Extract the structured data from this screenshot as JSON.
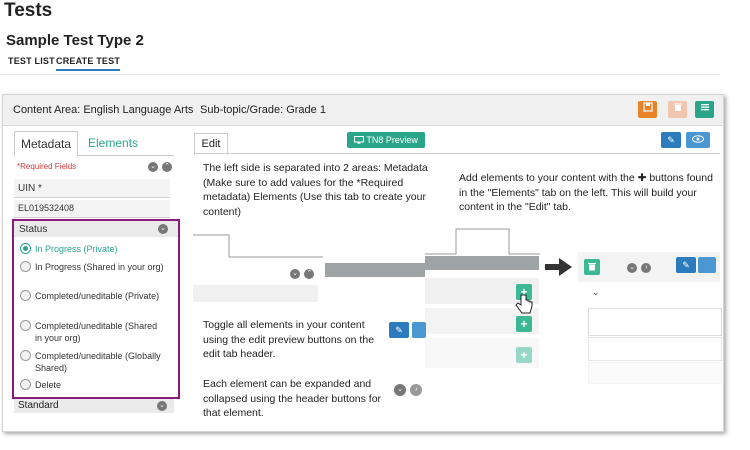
{
  "page": {
    "title": "Tests",
    "subtitle": "Sample Test Type 2",
    "tabs": [
      "TEST LIST",
      "CREATE TEST"
    ]
  },
  "header": {
    "content_area": "Content Area: English Language Arts",
    "subtopic": "Sub-topic/Grade: Grade 1",
    "colors": {
      "save": "#e8832a",
      "delete": "#f1c6ae",
      "menu": "#2aa58a"
    }
  },
  "left": {
    "tab_metadata": "Metadata",
    "tab_elements": "Elements",
    "required_note": "*Required Fields",
    "uin_label": "UIN *",
    "uin_value": "EL019532408",
    "status_label": "Status",
    "status_options": [
      "In Progress (Private)",
      "In Progress (Shared in your org)",
      "Completed/uneditable (Private)",
      "Completed/uneditable (Shared in your org)",
      "Completed/uneditable (Globally Shared)",
      "Delete"
    ],
    "standard_label": "Standard"
  },
  "right": {
    "edit_tab": "Edit",
    "preview_button": "TN8 Preview",
    "note1": "The left side is separated into 2 areas: Metadata (Make sure to add values for the *Required metadata) Elements (Use this tab to create your content)",
    "note2": "Add elements to your content with the ✚ buttons found in the \"Elements\" tab on the left. This will build your content in the \"Edit\" tab.",
    "note3": "Toggle all elements in your content using the edit preview buttons on the edit tab header.",
    "note4": "Each element can be expanded and collapsed using the header buttons for that element."
  }
}
